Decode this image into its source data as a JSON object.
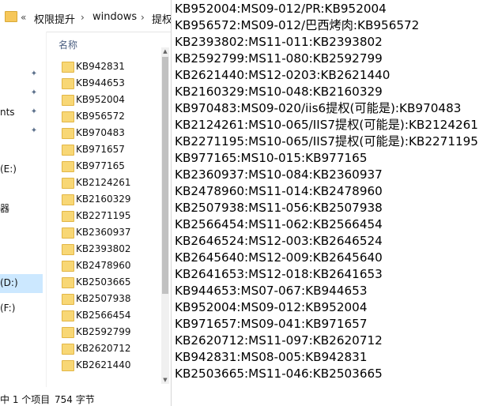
{
  "explorer": {
    "breadcrumb": {
      "chevron": "«",
      "items": [
        "权限提升",
        "windows",
        "提权"
      ],
      "separator": "›"
    },
    "nav_items": [
      "nts",
      "(E:)",
      "器",
      "(D:)",
      "(F:)"
    ],
    "column_header": "名称",
    "files": [
      "KB942831",
      "KB944653",
      "KB952004",
      "KB956572",
      "KB970483",
      "KB971657",
      "KB977165",
      "KB2124261",
      "KB2160329",
      "KB2271195",
      "KB2360937",
      "KB2393802",
      "KB2478960",
      "KB2503665",
      "KB2507938",
      "KB2566454",
      "KB2592799",
      "KB2620712",
      "KB2621440"
    ],
    "status": {
      "selected": "中 1 个项目",
      "size": "754 字节"
    }
  },
  "text_window": {
    "lines": [
      "KB952004:MS09-012/PR:KB952004",
      "KB956572:MS09-012/巴西烤肉:KB956572",
      "KB2393802:MS11-011:KB2393802",
      "KB2592799:MS11-080:KB2592799",
      "KB2621440:MS12-0203:KB2621440",
      "KB2160329:MS10-048:KB2160329",
      "KB970483:MS09-020/iis6提权(可能是):KB970483",
      "KB2124261:MS10-065/IIS7提权(可能是):KB2124261",
      "KB2271195:MS10-065/IIS7提权(可能是):KB2271195",
      "KB977165:MS10-015:KB977165",
      "KB2360937:MS10-084:KB2360937",
      "KB2478960:MS11-014:KB2478960",
      "KB2507938:MS11-056:KB2507938",
      "KB2566454:MS11-062:KB2566454",
      "KB2646524:MS12-003:KB2646524",
      "KB2645640:MS12-009:KB2645640",
      "KB2641653:MS12-018:KB2641653",
      "KB944653:MS07-067:KB944653",
      "KB952004:MS09-012:KB952004",
      "KB971657:MS09-041:KB971657",
      "KB2620712:MS11-097:KB2620712",
      "KB942831:MS08-005:KB942831",
      "KB2503665:MS11-046:KB2503665"
    ]
  },
  "colors": {
    "folder": "#f8d775",
    "selection": "#cce8ff",
    "header_text": "#4d6082"
  }
}
